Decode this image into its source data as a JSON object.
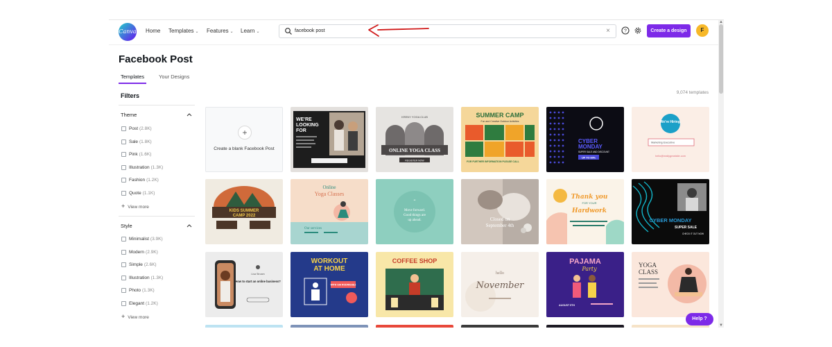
{
  "header": {
    "logo_text": "Canva",
    "nav": [
      {
        "label": "Home",
        "has_menu": false
      },
      {
        "label": "Templates",
        "has_menu": true
      },
      {
        "label": "Features",
        "has_menu": true
      },
      {
        "label": "Learn",
        "has_menu": true
      }
    ],
    "search_value": "facebook post",
    "create_label": "Create a design",
    "avatar_initial": "F",
    "help_icon": "question-circle-icon",
    "settings_icon": "gear-icon"
  },
  "page": {
    "title": "Facebook Post",
    "tabs": [
      {
        "label": "Templates",
        "active": true
      },
      {
        "label": "Your Designs",
        "active": false
      }
    ],
    "filters_title": "Filters",
    "template_count": "9,074 templates"
  },
  "filters": {
    "theme": {
      "title": "Theme",
      "options": [
        {
          "label": "Post",
          "count": "(2.8K)"
        },
        {
          "label": "Sale",
          "count": "(1.8K)"
        },
        {
          "label": "Pink",
          "count": "(1.6K)"
        },
        {
          "label": "Illustration",
          "count": "(1.3K)"
        },
        {
          "label": "Fashion",
          "count": "(1.2K)"
        },
        {
          "label": "Quote",
          "count": "(1.1K)"
        }
      ],
      "more": "View more"
    },
    "style": {
      "title": "Style",
      "options": [
        {
          "label": "Minimalist",
          "count": "(3.9K)"
        },
        {
          "label": "Modern",
          "count": "(2.9K)"
        },
        {
          "label": "Simple",
          "count": "(2.6K)"
        },
        {
          "label": "Illustration",
          "count": "(1.3K)"
        },
        {
          "label": "Photo",
          "count": "(1.3K)"
        },
        {
          "label": "Elegant",
          "count": "(1.2K)"
        }
      ],
      "more": "View more"
    }
  },
  "blank_tile": {
    "label": "Create a blank Facebook Post"
  },
  "templates": {
    "row1": {
      "t1": {
        "l1": "WE'RE",
        "l2": "LOOKING",
        "l3": "FOR"
      },
      "t2": {
        "club": "KRENY YOGA CLUB",
        "title": "ONLINE YOGA CLASS",
        "cta": "REGISTER NOW"
      },
      "t3": {
        "title": "SUMMER CAMP",
        "sub": "Fun and Creative Outdoor Activities",
        "contact": "FOR FURTHER INFORMATION PLEASE CALL"
      },
      "t4": {
        "l1": "CYBER",
        "l2": "MONDAY",
        "sub": "SUPER SALE AND DISCOUNT",
        "badge": "UP TO 60%"
      },
      "t5": {
        "badge": "We're Hiring.",
        "field": "Marketing Executive",
        "email": "hello@reallygreatsite.com"
      }
    },
    "row2": {
      "t1": {
        "l1": "KIDS SUMMER",
        "l2": "CAMP 2022"
      },
      "t2": {
        "l1": "Online",
        "l2": "Yoga Classes",
        "sub": "Our services"
      },
      "t3": {
        "l1": "Move forward.",
        "l2": "Good things are",
        "l3": "up ahead."
      },
      "t4": {
        "l1": "Closed on",
        "l2": "September 4th"
      },
      "t5": {
        "l1": "Thank you",
        "l2": "FOR YOUR",
        "l3": "Hardwork"
      },
      "t6": {
        "l1": "CYBER MONDAY",
        "l2": "SUPER SALE",
        "l3": "CHECK IT OUT NOW"
      }
    },
    "row3": {
      "t1": {
        "name": "Lisa Stroam",
        "quote": "How to start an online business?"
      },
      "t2": {
        "l1": "WORKOUT",
        "l2": "AT HOME",
        "badge": "WITH GIA RODRIGUEZ"
      },
      "t3": {
        "title": "COFFEE SHOP"
      },
      "t4": {
        "l1": "hello",
        "l2": "November"
      },
      "t5": {
        "l1": "PAJAMA",
        "l2": "Party",
        "info": "AUGUST 5TH"
      },
      "t6": {
        "l1": "YOGA",
        "l2": "CLASS"
      }
    }
  },
  "help_label": "Help ?",
  "colors": {
    "accent": "#7d2ae8",
    "arrow": "#d01818"
  }
}
